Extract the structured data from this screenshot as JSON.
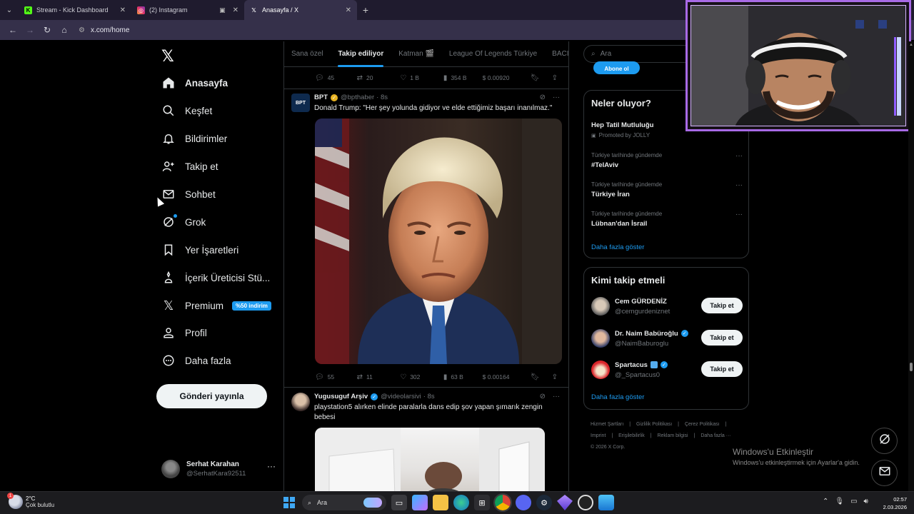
{
  "browser": {
    "tabs": [
      {
        "label": "Stream - Kick Dashboard",
        "icon": "kick-icon",
        "color": "#53fc18"
      },
      {
        "label": "(2) Instagram",
        "icon": "instagram-icon",
        "color": "#e1306c"
      },
      {
        "label": "Anasayfa / X",
        "icon": "x-icon",
        "color": "#ffffff"
      }
    ],
    "url": "x.com/home"
  },
  "nav": {
    "items": [
      {
        "label": "Anasayfa",
        "icon": "home-icon"
      },
      {
        "label": "Keşfet",
        "icon": "search-icon"
      },
      {
        "label": "Bildirimler",
        "icon": "bell-icon"
      },
      {
        "label": "Takip et",
        "icon": "add-user-icon"
      },
      {
        "label": "Sohbet",
        "icon": "mail-icon"
      },
      {
        "label": "Grok",
        "icon": "grok-icon"
      },
      {
        "label": "Yer İşaretleri",
        "icon": "bookmark-icon"
      },
      {
        "label": "İçerik Üreticisi Stü...",
        "icon": "creator-studio-icon"
      },
      {
        "label": "Premium",
        "icon": "x-premium-icon"
      },
      {
        "label": "Profil",
        "icon": "person-icon"
      },
      {
        "label": "Daha fazla",
        "icon": "more-circle-icon"
      }
    ],
    "premium_badge": "%50 indirim",
    "post_button": "Gönderi yayınla",
    "account": {
      "name": "Serhat Karahan",
      "handle": "@SerhatKara92511",
      "more": "···"
    }
  },
  "feed": {
    "tabs": [
      "Sana özel",
      "Takip ediliyor",
      "Katman 🎬",
      "League Of Legends Türkiye",
      "BACII"
    ],
    "active_tab": "Takip ediliyor",
    "top_actions": {
      "replies": "45",
      "reposts": "20",
      "likes": "1 B",
      "views": "354 B",
      "tips": "$ 0.00920"
    },
    "tweets": [
      {
        "name": "BPT",
        "handle": "@bpthaber",
        "time": "· 8s",
        "text": "Donald Trump: \"Her şey yolunda gidiyor ve elde ettiğimiz başarı inanılmaz.\"",
        "avatar_label": "BPT",
        "actions": {
          "replies": "55",
          "reposts": "11",
          "likes": "302",
          "views": "63 B",
          "tips": "$ 0.00164"
        }
      },
      {
        "name": "Yugusuguf Arşiv",
        "handle": "@videolarsivi",
        "time": "· 8s",
        "text": "playstation5 alırken elinde paralarla dans edip şov yapan şımarık zengin bebesi"
      }
    ]
  },
  "sidebar": {
    "search_placeholder": "Ara",
    "subscribe_button": "Abone ol",
    "trends_title": "Neler oluyor?",
    "promoted": {
      "title": "Hep Tatil Mutluluğu",
      "note": "Promoted by JOLLY"
    },
    "trends": [
      {
        "category": "Türkiye tarihinde gündemde",
        "title": "#TelAviv"
      },
      {
        "category": "Türkiye tarihinde gündemde",
        "title": "Türkiye İran"
      },
      {
        "category": "Türkiye tarihinde gündemde",
        "title": "Lübnan'dan İsrail"
      }
    ],
    "show_more": "Daha fazla göster",
    "who_title": "Kimi takip etmeli",
    "who": [
      {
        "name": "Cem GÜRDENİZ",
        "handle": "@cemgurdeniznet",
        "verified": false
      },
      {
        "name": "Dr. Naim Babüroğlu",
        "handle": "@NaimBaburoglu",
        "verified": true
      },
      {
        "name": "Spartacus",
        "handle": "@_Spartacus0",
        "verified": true
      }
    ],
    "follow_label": "Takip et",
    "footer": [
      "Hizmet Şartları",
      "|",
      "Gizlilik Politikası",
      "|",
      "Çerez Politikası",
      "|",
      "Imprint",
      "|",
      "Erişilebilirlik",
      "|",
      "Reklam bilgisi",
      "|",
      "Daha fazla ···",
      "© 2026 X Corp."
    ]
  },
  "windows": {
    "activate_title": "Windows'u Etkinleştir",
    "activate_sub": "Windows'u etkinleştirmek için Ayarlar'a gidin.",
    "weather_temp": "2°C",
    "weather_desc": "Çok bulutlu",
    "weather_badge": "1",
    "search_label": "Ara",
    "time": "02:57",
    "date": "2.03.2026"
  }
}
